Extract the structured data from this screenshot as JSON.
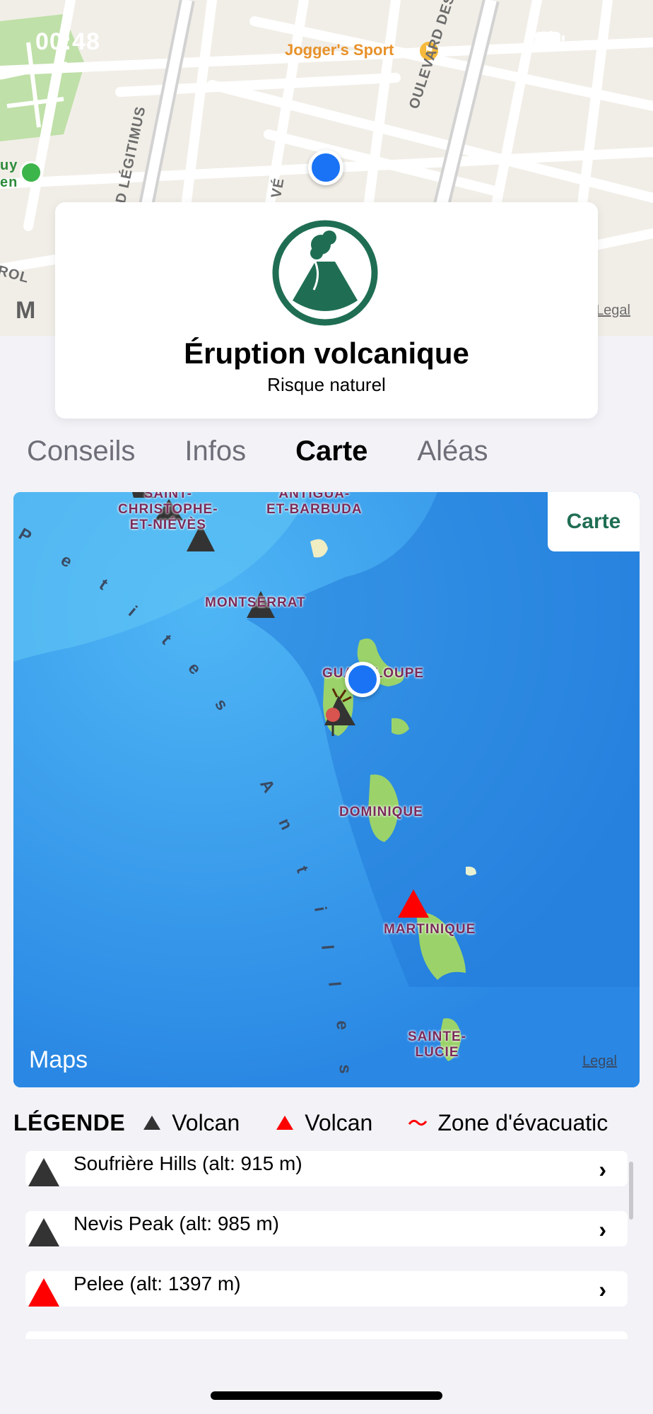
{
  "status_bar": {
    "time": "00:48"
  },
  "top_map": {
    "poi_label": "Jogger's Sport",
    "streets": [
      "OULEVARD DES HÉROS",
      "D LÉGITIMUS",
      "VÉ",
      "ROL"
    ],
    "side_label": "uy\nen",
    "legal": "Legal",
    "apple_mark": "M"
  },
  "header": {
    "title": "Éruption volcanique",
    "subtitle": "Risque naturel",
    "icon": "volcano-icon",
    "accent_color": "#1f6e53"
  },
  "tabs": [
    {
      "label": "Conseils",
      "active": false
    },
    {
      "label": "Infos",
      "active": false
    },
    {
      "label": "Carte",
      "active": true
    },
    {
      "label": "Aléas",
      "active": false
    }
  ],
  "map": {
    "button_label": "Carte",
    "maps_brand": "Maps",
    "legal": "Legal",
    "labels": {
      "saint_christophe": "SAINT-\nCHRISTOPHE-\nET-NIÉVÈS",
      "antigua": "ANTIGUA-\nET-BARBUDA",
      "montserrat": "MONTSERRAT",
      "guadeloupe": "GUADELOUPE",
      "dominique": "DOMINIQUE",
      "martinique": "MARTINIQUE",
      "sainte_lucie": "SAINTE-\nLUCIE"
    },
    "sea_text": "Petites Antilles"
  },
  "legend": {
    "title": "LÉGENDE",
    "items": [
      {
        "label": "Volcan",
        "color": "#333333",
        "icon": "triangle-icon"
      },
      {
        "label": "Volcan",
        "color": "#ff0000",
        "icon": "triangle-icon"
      },
      {
        "label": "Zone d'évacuatic",
        "color": "#ff0000",
        "icon": "wave-icon"
      }
    ]
  },
  "volcanoes": [
    {
      "name": "Soufrière Hills (alt: 915 m)",
      "color": "#333333"
    },
    {
      "name": "Nevis Peak (alt: 985 m)",
      "color": "#333333"
    },
    {
      "name": "Pelee (alt: 1397 m)",
      "color": "#ff0000"
    }
  ]
}
